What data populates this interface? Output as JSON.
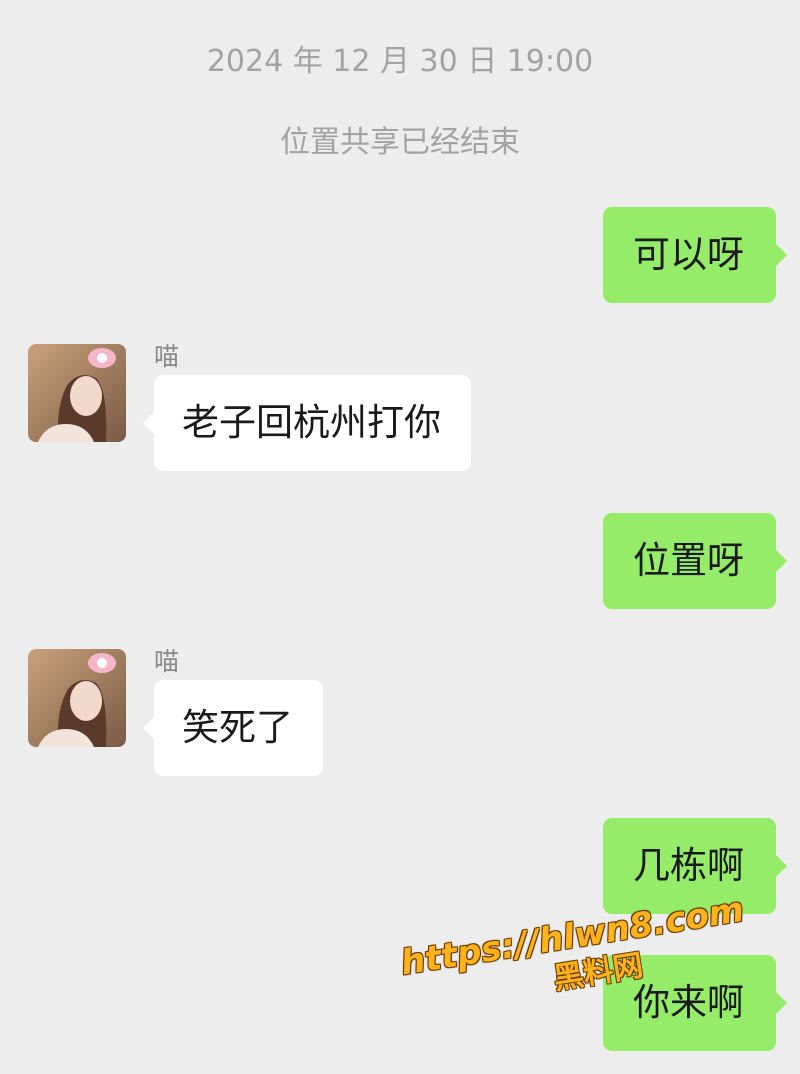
{
  "chat": {
    "timestamp": "2024 年 12 月 30 日 19:00",
    "system_note": "位置共享已经结束",
    "messages": [
      {
        "direction": "out",
        "text": "可以呀"
      },
      {
        "direction": "in",
        "sender": "喵",
        "text": "老子回杭州打你"
      },
      {
        "direction": "out",
        "text": "位置呀"
      },
      {
        "direction": "in",
        "sender": "喵",
        "text": "笑死了"
      },
      {
        "direction": "out",
        "text": "几栋啊"
      },
      {
        "direction": "out",
        "text": "你来啊"
      }
    ]
  },
  "watermark": {
    "url": "https://hlwn8.com",
    "name": "黑料网"
  },
  "colors": {
    "background": "#ededed",
    "outgoing_bubble": "#95ec69",
    "incoming_bubble": "#ffffff",
    "meta_text": "#a3a3a3",
    "watermark": "#ffb31a"
  }
}
